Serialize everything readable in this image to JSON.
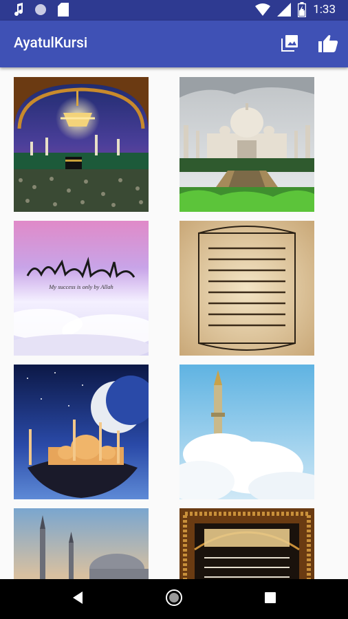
{
  "status_bar": {
    "time": "1:33",
    "icons": [
      "music-note-icon",
      "circle-icon",
      "sd-card-icon",
      "wifi-icon",
      "signal-icon",
      "battery-icon"
    ]
  },
  "app_bar": {
    "title": "AyatulKursi",
    "actions": [
      "gallery-icon",
      "thumbs-up-icon"
    ],
    "color": "#3f51b5"
  },
  "tiles": [
    {
      "name": "mecca-kaaba-image"
    },
    {
      "name": "taj-mahal-image"
    },
    {
      "name": "calligraphy-clouds-image",
      "caption": "My success is only by Allah"
    },
    {
      "name": "parchment-calligraphy-image"
    },
    {
      "name": "floating-mosque-moon-image"
    },
    {
      "name": "minaret-clouds-image"
    },
    {
      "name": "mosque-domes-image"
    },
    {
      "name": "ayatul-kursi-panel-image"
    }
  ],
  "nav_bar": {
    "icons": [
      "back-icon",
      "home-icon",
      "recents-icon"
    ]
  }
}
